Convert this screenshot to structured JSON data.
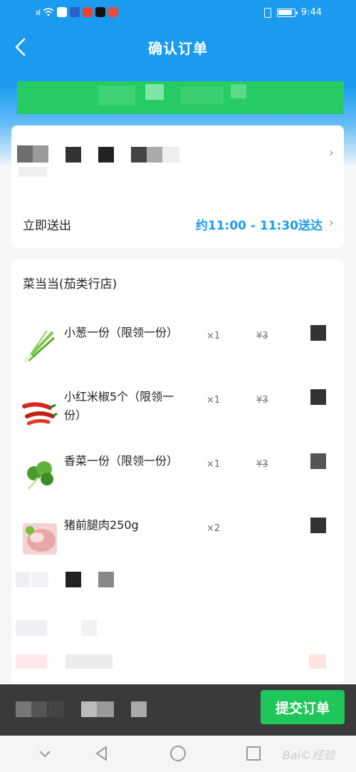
{
  "status_bar": {
    "signal": "⁴ᴳ ill",
    "time": "9:44"
  },
  "header": {
    "title": "确认订单",
    "back_icon": "chevron-left-icon"
  },
  "delivery": {
    "label": "立即送出",
    "time": "约11:00 - 11:30送达"
  },
  "shop": {
    "name": "菜当当(茄类行店)",
    "items": [
      {
        "name": "小葱一份（限领一份）",
        "qty": "×1",
        "old_price": "¥3",
        "icon": "green-onion-image"
      },
      {
        "name": "小红米椒5个（限领一份）",
        "qty": "×1",
        "old_price": "¥3",
        "icon": "red-chili-image"
      },
      {
        "name": "香菜一份（限领一份）",
        "qty": "×1",
        "old_price": "¥3",
        "icon": "coriander-image"
      },
      {
        "name": "猪前腿肉250g",
        "qty": "×2",
        "old_price": "",
        "icon": "pork-image"
      }
    ]
  },
  "bottom": {
    "submit_label": "提交订单"
  },
  "watermark": "Bai©经验",
  "colors": {
    "brand_blue": "#1a9bf0",
    "submit_green": "#1fc65a",
    "banner_green": "#26cc63"
  }
}
